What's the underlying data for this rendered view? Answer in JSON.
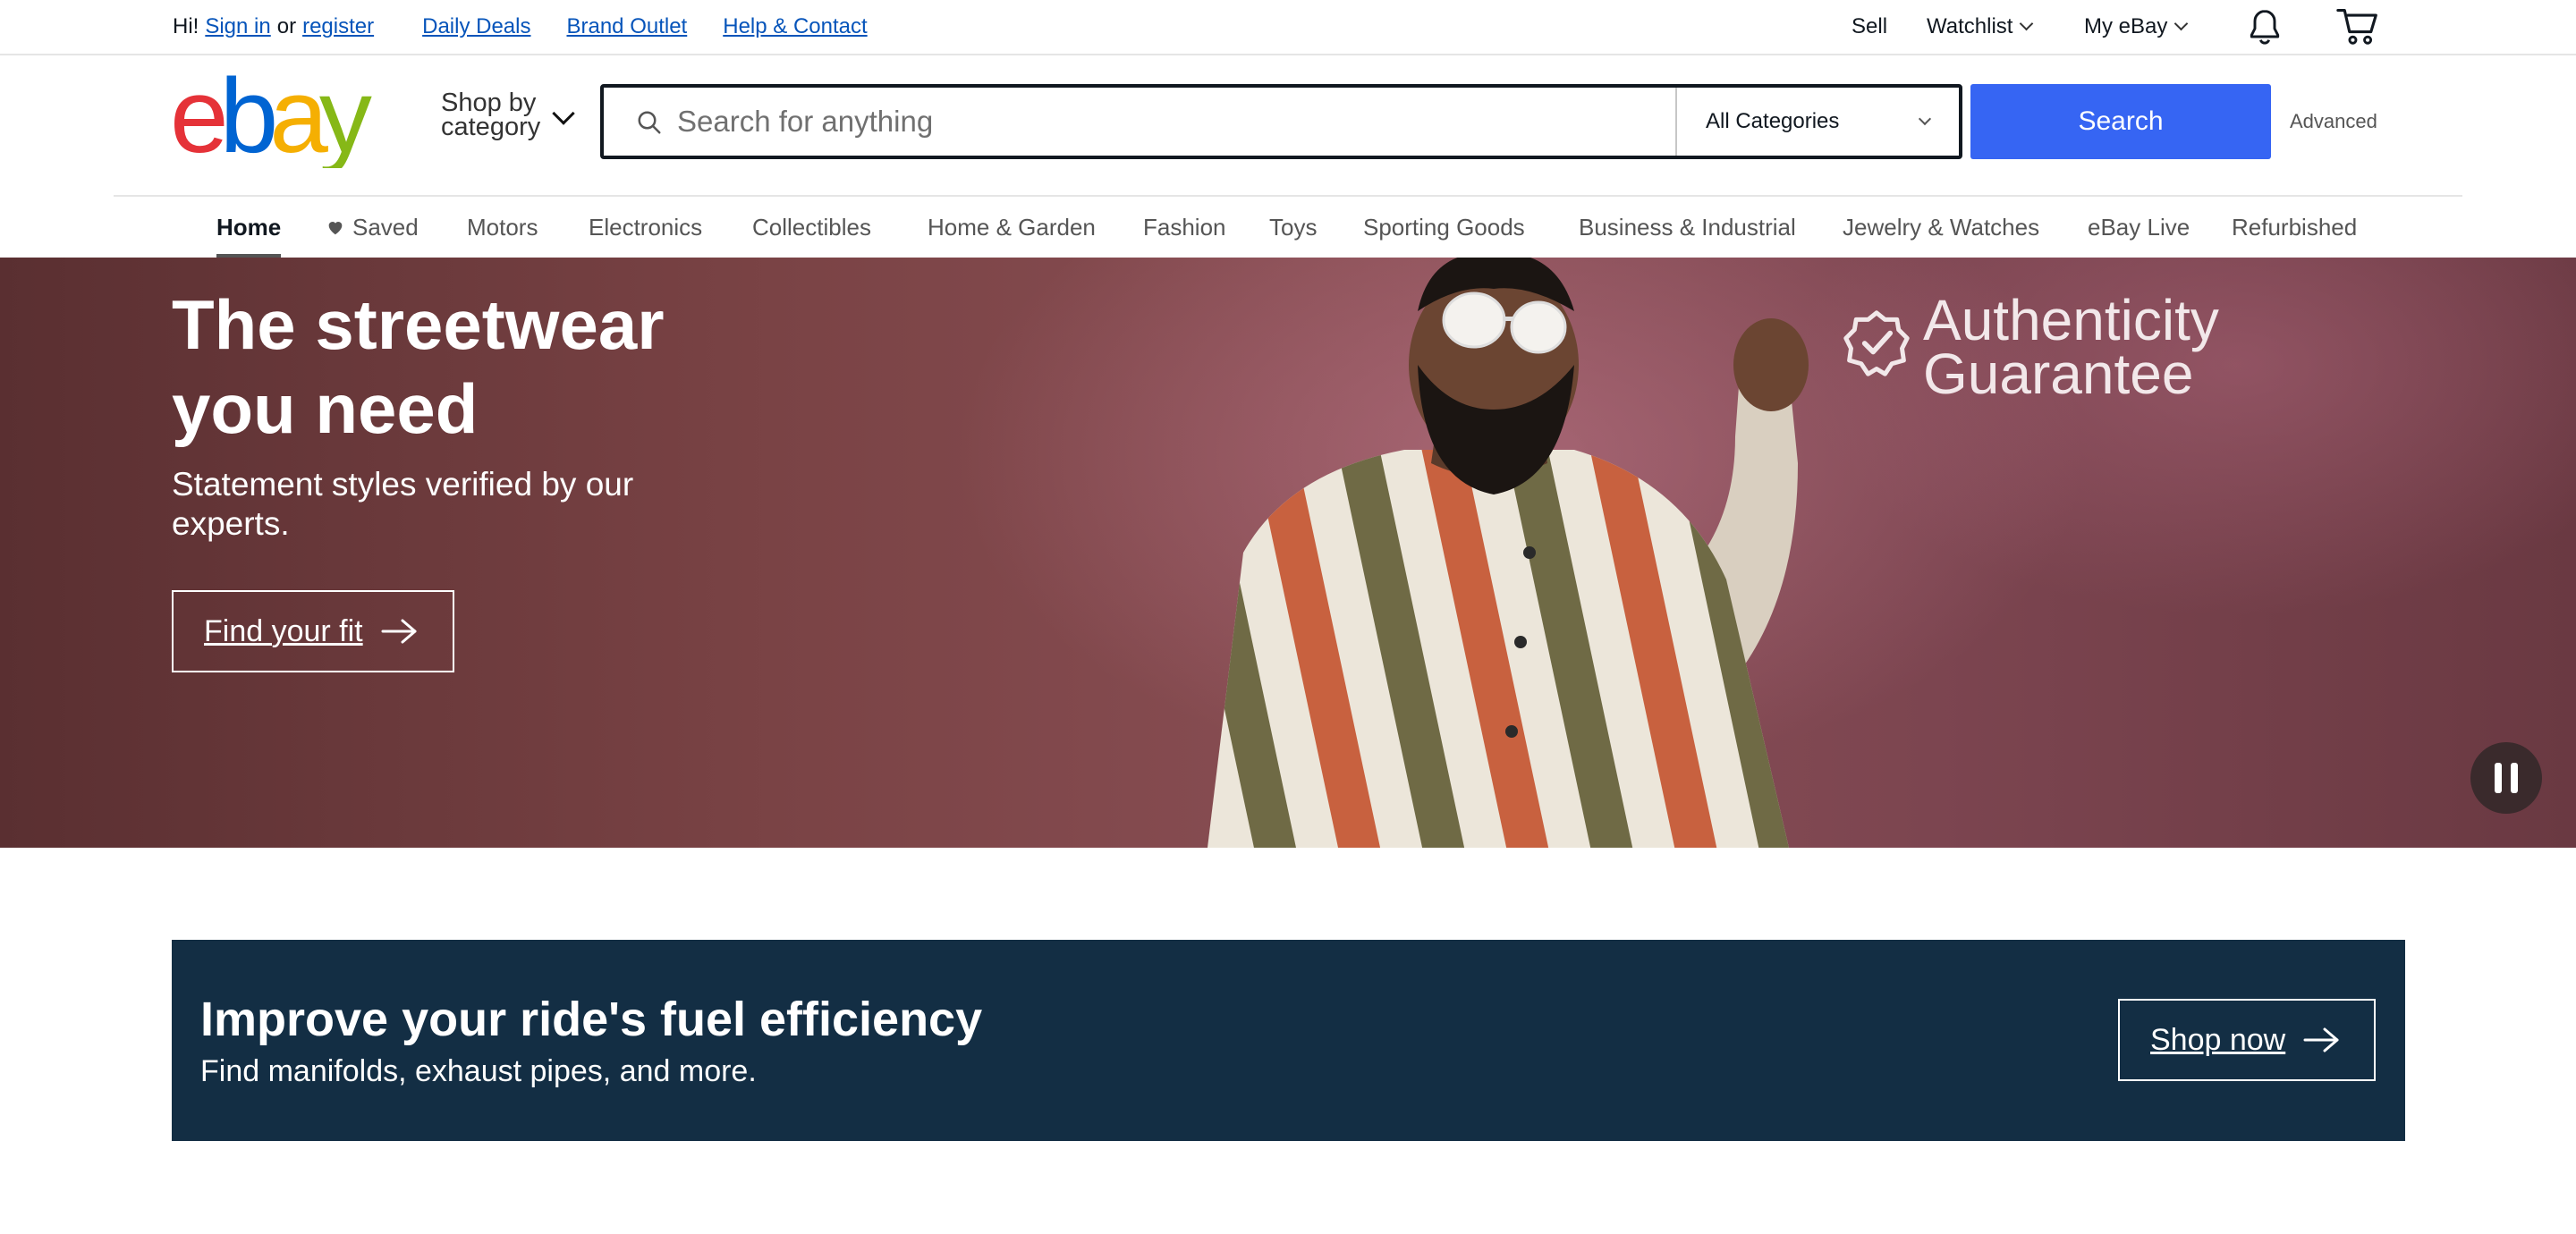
{
  "topbar": {
    "greeting": "Hi!",
    "sign_in": "Sign in",
    "or": "or",
    "register": "register",
    "daily_deals": "Daily Deals",
    "brand_outlet": "Brand Outlet",
    "help_contact": "Help & Contact",
    "sell": "Sell",
    "watchlist": "Watchlist",
    "my_ebay": "My eBay",
    "notification_icon": "bell-icon",
    "cart_icon": "cart-icon"
  },
  "header": {
    "logo_text": "ebay",
    "logo_colors": [
      "#e53238",
      "#0064d2",
      "#f5af02",
      "#86b817"
    ],
    "shop_by_line1": "Shop by",
    "shop_by_line2": "category",
    "search_placeholder": "Search for anything",
    "category_selected": "All Categories",
    "search_button": "Search",
    "advanced": "Advanced",
    "accent_color": "#3665f3"
  },
  "nav": {
    "items": [
      {
        "label": "Home",
        "active": true
      },
      {
        "label": "Saved"
      },
      {
        "label": "Motors"
      },
      {
        "label": "Electronics"
      },
      {
        "label": "Collectibles"
      },
      {
        "label": "Home & Garden"
      },
      {
        "label": "Fashion"
      },
      {
        "label": "Toys"
      },
      {
        "label": "Sporting Goods"
      },
      {
        "label": "Business & Industrial"
      },
      {
        "label": "Jewelry & Watches"
      },
      {
        "label": "eBay Live"
      },
      {
        "label": "Refurbished"
      }
    ]
  },
  "hero": {
    "title": "The streetwear you need",
    "subtitle": "Statement styles verified by our experts.",
    "cta": "Find your fit",
    "badge_line1": "Authenticity",
    "badge_line2": "Guarantee",
    "pause_icon": "pause-icon"
  },
  "promo": {
    "title": "Improve your ride's fuel efficiency",
    "subtitle": "Find manifolds, exhaust pipes, and more.",
    "cta": "Shop now",
    "background": "#132e44"
  }
}
